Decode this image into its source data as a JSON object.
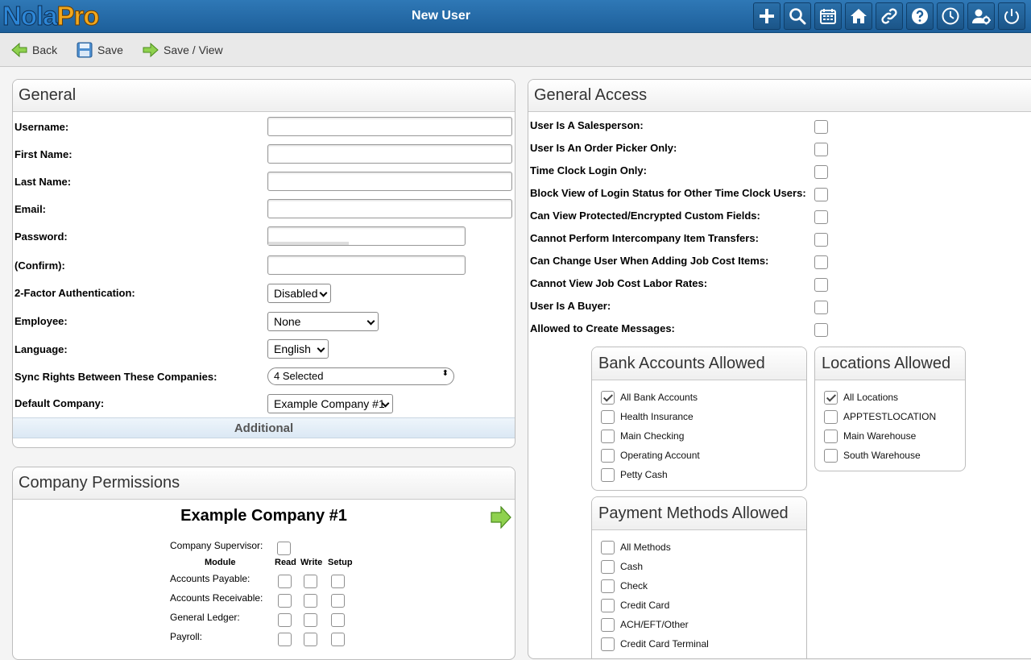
{
  "app": {
    "logo_nola": "Nola",
    "logo_pro": "Pro",
    "title": "New User"
  },
  "topbar_icons": [
    "plus-icon",
    "search-icon",
    "calendar-icon",
    "home-icon",
    "link-icon",
    "help-icon",
    "clock-icon",
    "user-settings-icon",
    "power-icon"
  ],
  "toolbar": {
    "back": "Back",
    "save": "Save",
    "save_view": "Save / View"
  },
  "general": {
    "title": "General",
    "username_label": "Username:",
    "first_name_label": "First Name:",
    "last_name_label": "Last Name:",
    "email_label": "Email:",
    "password_label": "Password:",
    "confirm_label": "(Confirm):",
    "twofa_label": "2-Factor Authentication:",
    "twofa_value": "Disabled",
    "employee_label": "Employee:",
    "employee_value": "None",
    "language_label": "Language:",
    "language_value": "English",
    "sync_label": "Sync Rights Between These Companies:",
    "sync_value": "4 Selected",
    "default_company_label": "Default Company:",
    "default_company_value": "Example Company #1",
    "additional": "Additional"
  },
  "permissions": {
    "title": "Company Permissions",
    "company": "Example Company #1",
    "supervisor": "Company Supervisor:",
    "col_module": "Module",
    "col_read": "Read",
    "col_write": "Write",
    "col_setup": "Setup",
    "modules": [
      "Accounts Payable:",
      "Accounts Receivable:",
      "General Ledger:",
      "Payroll:"
    ]
  },
  "general_access": {
    "title": "General Access",
    "items": [
      "User Is A Salesperson:",
      "User Is An Order Picker Only:",
      "Time Clock Login Only:",
      "Block View of Login Status for Other Time Clock Users:",
      "Can View Protected/Encrypted Custom Fields:",
      "Cannot Perform Intercompany Item Transfers:",
      "Can Change User When Adding Job Cost Items:",
      "Cannot View Job Cost Labor Rates:",
      "User Is A Buyer:",
      "Allowed to Create Messages:"
    ]
  },
  "bank_accounts": {
    "title": "Bank Accounts Allowed",
    "items": [
      "All Bank Accounts",
      "Health Insurance",
      "Main Checking",
      "Operating Account",
      "Petty Cash"
    ],
    "checked": [
      true,
      false,
      false,
      false,
      false
    ]
  },
  "locations": {
    "title": "Locations Allowed",
    "items": [
      "All Locations",
      "APPTESTLOCATION",
      "Main Warehouse",
      "South Warehouse"
    ],
    "checked": [
      true,
      false,
      false,
      false
    ]
  },
  "payment_methods": {
    "title": "Payment Methods Allowed",
    "items": [
      "All Methods",
      "Cash",
      "Check",
      "Credit Card",
      "ACH/EFT/Other",
      "Credit Card Terminal"
    ],
    "checked": [
      false,
      false,
      false,
      false,
      false,
      false
    ]
  }
}
